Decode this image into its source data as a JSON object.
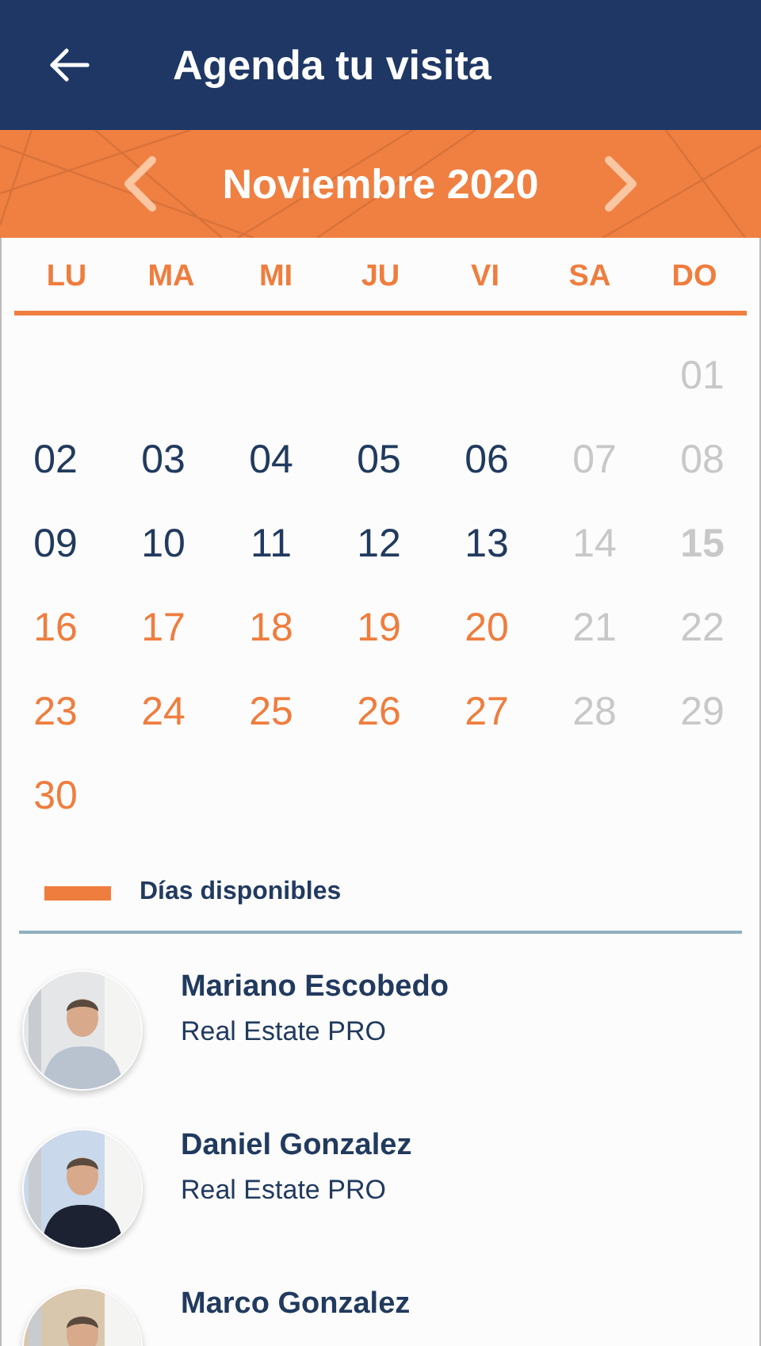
{
  "app_bar": {
    "title": "Agenda tu visita"
  },
  "calendar": {
    "month": "Noviembre 2020",
    "weekdays": [
      "LU",
      "MA",
      "MI",
      "JU",
      "VI",
      "SA",
      "DO"
    ],
    "weeks": [
      [
        {
          "day": "01",
          "kind": "disabled"
        }
      ],
      [
        {
          "day": "02",
          "kind": "regular"
        },
        {
          "day": "03",
          "kind": "regular"
        },
        {
          "day": "04",
          "kind": "regular"
        },
        {
          "day": "05",
          "kind": "regular"
        },
        {
          "day": "06",
          "kind": "regular"
        },
        {
          "day": "07",
          "kind": "disabled"
        },
        {
          "day": "08",
          "kind": "disabled"
        }
      ],
      [
        {
          "day": "09",
          "kind": "regular"
        },
        {
          "day": "10",
          "kind": "regular"
        },
        {
          "day": "11",
          "kind": "regular"
        },
        {
          "day": "12",
          "kind": "regular"
        },
        {
          "day": "13",
          "kind": "regular"
        },
        {
          "day": "14",
          "kind": "disabled"
        },
        {
          "day": "15",
          "kind": "today"
        }
      ],
      [
        {
          "day": "16",
          "kind": "available"
        },
        {
          "day": "17",
          "kind": "available"
        },
        {
          "day": "18",
          "kind": "available"
        },
        {
          "day": "19",
          "kind": "available"
        },
        {
          "day": "20",
          "kind": "available"
        },
        {
          "day": "21",
          "kind": "disabled"
        },
        {
          "day": "22",
          "kind": "disabled"
        }
      ],
      [
        {
          "day": "23",
          "kind": "available"
        },
        {
          "day": "24",
          "kind": "available"
        },
        {
          "day": "25",
          "kind": "available"
        },
        {
          "day": "26",
          "kind": "available"
        },
        {
          "day": "27",
          "kind": "available"
        },
        {
          "day": "28",
          "kind": "disabled"
        },
        {
          "day": "29",
          "kind": "disabled"
        }
      ],
      [
        {
          "day": "30",
          "kind": "available"
        }
      ]
    ]
  },
  "legend": {
    "label": "Días disponibles"
  },
  "agents": [
    {
      "name": "Mariano Escobedo",
      "role": "Real Estate PRO"
    },
    {
      "name": "Daniel Gonzalez",
      "role": "Real Estate PRO"
    },
    {
      "name": "Marco Gonzalez"
    }
  ]
}
